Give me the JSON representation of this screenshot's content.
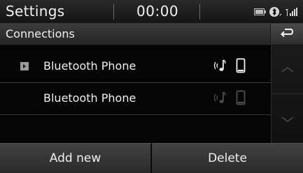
{
  "status_bar": {
    "title": "Settings",
    "clock": "00:00",
    "icons": [
      "battery-icon",
      "bluetooth-icon",
      "signal-icon"
    ]
  },
  "header": {
    "title": "Connections",
    "back_icon": "back-arrow-icon"
  },
  "devices": [
    {
      "label": "Bluetooth Phone",
      "selected": true,
      "icons": [
        "audio-streaming-icon",
        "phone-icon"
      ],
      "icons_active": true
    },
    {
      "label": "Bluetooth Phone",
      "selected": false,
      "icons": [
        "audio-streaming-icon",
        "phone-icon"
      ],
      "icons_active": false
    }
  ],
  "scroll": {
    "up_icon": "chevron-up-icon",
    "down_icon": "chevron-down-icon"
  },
  "buttons": {
    "add_new": "Add new",
    "delete": "Delete"
  },
  "colors": {
    "icon_active": "#f2f2f2",
    "icon_inactive": "#5a5a5a",
    "background": "#000000"
  }
}
